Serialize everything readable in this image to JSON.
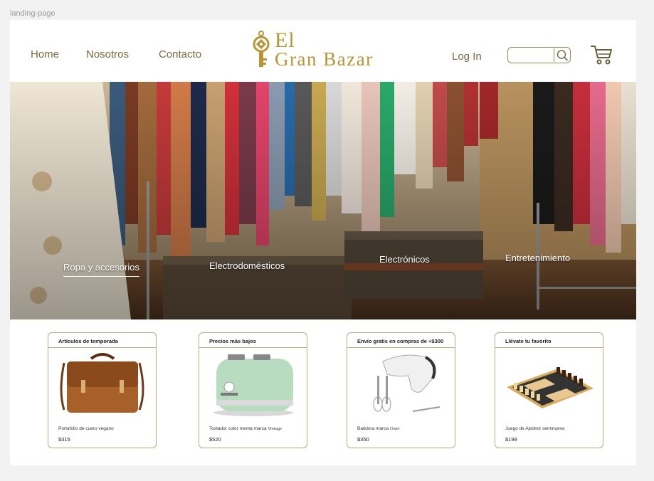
{
  "frame": {
    "label": "landing-page"
  },
  "nav": {
    "home": "Home",
    "about": "Nosotros",
    "contact": "Contacto"
  },
  "brand": {
    "line1": "El",
    "line2": "Gran Bazar",
    "color": "#b89436"
  },
  "header": {
    "login": "Log In",
    "search_placeholder": ""
  },
  "categories": [
    {
      "label": "Ropa y accesorios",
      "active": true
    },
    {
      "label": "Electrodomésticos"
    },
    {
      "label": "Electrónicos"
    },
    {
      "label": "Entretenimiento"
    }
  ],
  "cards": [
    {
      "heading": "Artículos de temporada",
      "name": "Portafolio de cuero vegano",
      "price": "$315"
    },
    {
      "heading": "Precios más bajos",
      "name": "Tostador color menta marca",
      "brand": "Vintage",
      "price": "$520"
    },
    {
      "heading": "Envío gratis en compras de +$300",
      "name": "Batidora marca",
      "brand": "Oster",
      "price": "$350"
    },
    {
      "heading": "Llévate tu favorito",
      "name": "Juego de Ajedrez seminuevo",
      "price": "$199"
    }
  ],
  "colors": {
    "accent_text": "#7a6a3e",
    "card_border": "#b8ab82"
  }
}
